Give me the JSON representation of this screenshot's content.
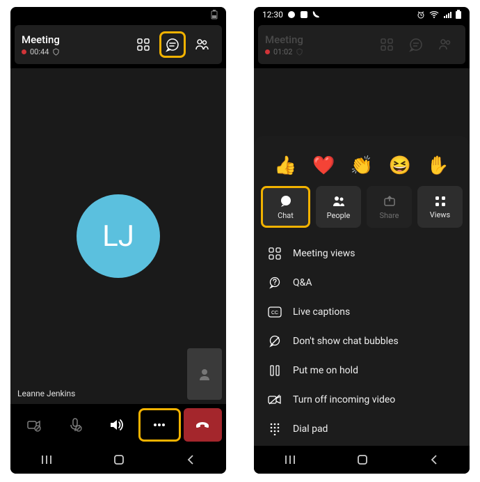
{
  "left": {
    "title": "Meeting",
    "timer": "00:44",
    "avatar_initials": "LJ",
    "participant_name": "Leanne Jenkins"
  },
  "right": {
    "status_time": "12:30",
    "title": "Meeting",
    "timer": "01:02",
    "reactions": [
      "👍",
      "❤️",
      "👏",
      "😆",
      "✋"
    ],
    "tiles": [
      {
        "label": "Chat"
      },
      {
        "label": "People"
      },
      {
        "label": "Share"
      },
      {
        "label": "Views"
      }
    ],
    "menu": [
      {
        "label": "Meeting views"
      },
      {
        "label": "Q&A"
      },
      {
        "label": "Live captions"
      },
      {
        "label": "Don't show chat bubbles"
      },
      {
        "label": "Put me on hold"
      },
      {
        "label": "Turn off incoming video"
      },
      {
        "label": "Dial pad"
      }
    ]
  }
}
